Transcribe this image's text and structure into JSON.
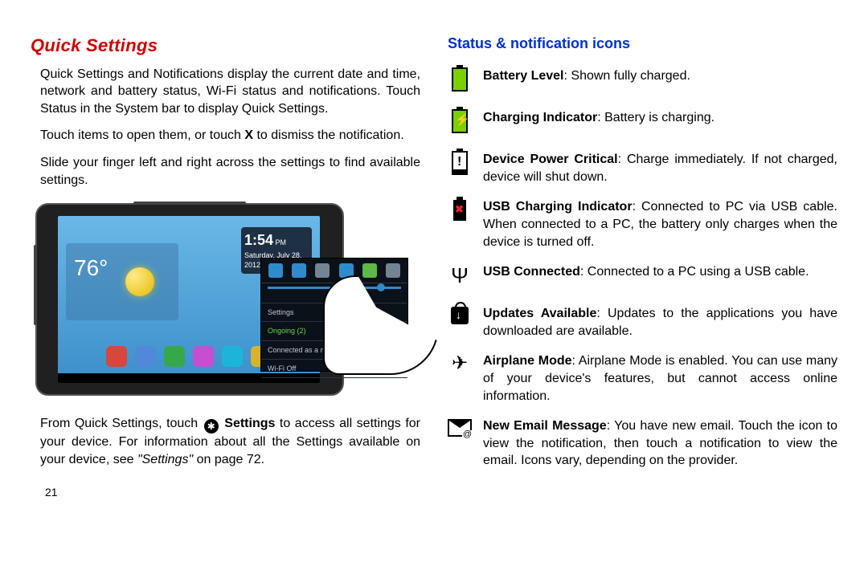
{
  "left": {
    "heading": "Quick Settings",
    "p1": "Quick Settings and Notifications display the current date and time, network and battery status, Wi-Fi status and notifications. Touch Status in the System bar to display Quick Settings.",
    "p2a": "Touch items to open them, or touch ",
    "p2b": "X",
    "p2c": " to dismiss the notification.",
    "p3": "Slide your finger left and right across the settings to find available settings.",
    "fig": {
      "temp": "76°",
      "time": "1:54",
      "time_ampm": "PM",
      "date": "Saturday, July 28, 2012",
      "settings_label": "Settings",
      "ongoing_label": "Ongoing (2)",
      "line_media": "Connected as a media device",
      "line_wifi": "Wi-Fi Off"
    },
    "p4a": "From Quick Settings, touch ",
    "p4b": "Settings",
    "p4c": " to access all settings for your device. For information about all the Settings available on your device, see ",
    "p4d": "\"Settings\"",
    "p4e": " on page 72.",
    "page_number": "21"
  },
  "right": {
    "heading": "Status & notification icons",
    "items": [
      {
        "icon": "battery-full",
        "label": "Battery Level",
        "text": ": Shown fully charged."
      },
      {
        "icon": "battery-charging",
        "label": "Charging Indicator",
        "text": ": Battery is charging."
      },
      {
        "icon": "battery-critical",
        "label": "Device Power Critical",
        "text": ": Charge immediately. If not charged, device will shut down."
      },
      {
        "icon": "battery-usb-x",
        "label": "USB Charging Indicator",
        "text": ": Connected to PC via USB cable. When connected to a PC, the battery only charges when the device is turned off."
      },
      {
        "icon": "usb",
        "label": "USB Connected",
        "text": ": Connected to a PC using a USB cable."
      },
      {
        "icon": "updates-bag",
        "label": "Updates Available",
        "text": ": Updates to the applications you have downloaded are available."
      },
      {
        "icon": "airplane",
        "label": "Airplane Mode",
        "text": ": Airplane Mode is enabled. You can use many of your device's features, but cannot access online information."
      },
      {
        "icon": "email",
        "label": "New Email Message",
        "text": ": You have new email. Touch the icon to view the notification, then touch a notification to view the email. Icons vary, depending on the provider."
      }
    ]
  }
}
